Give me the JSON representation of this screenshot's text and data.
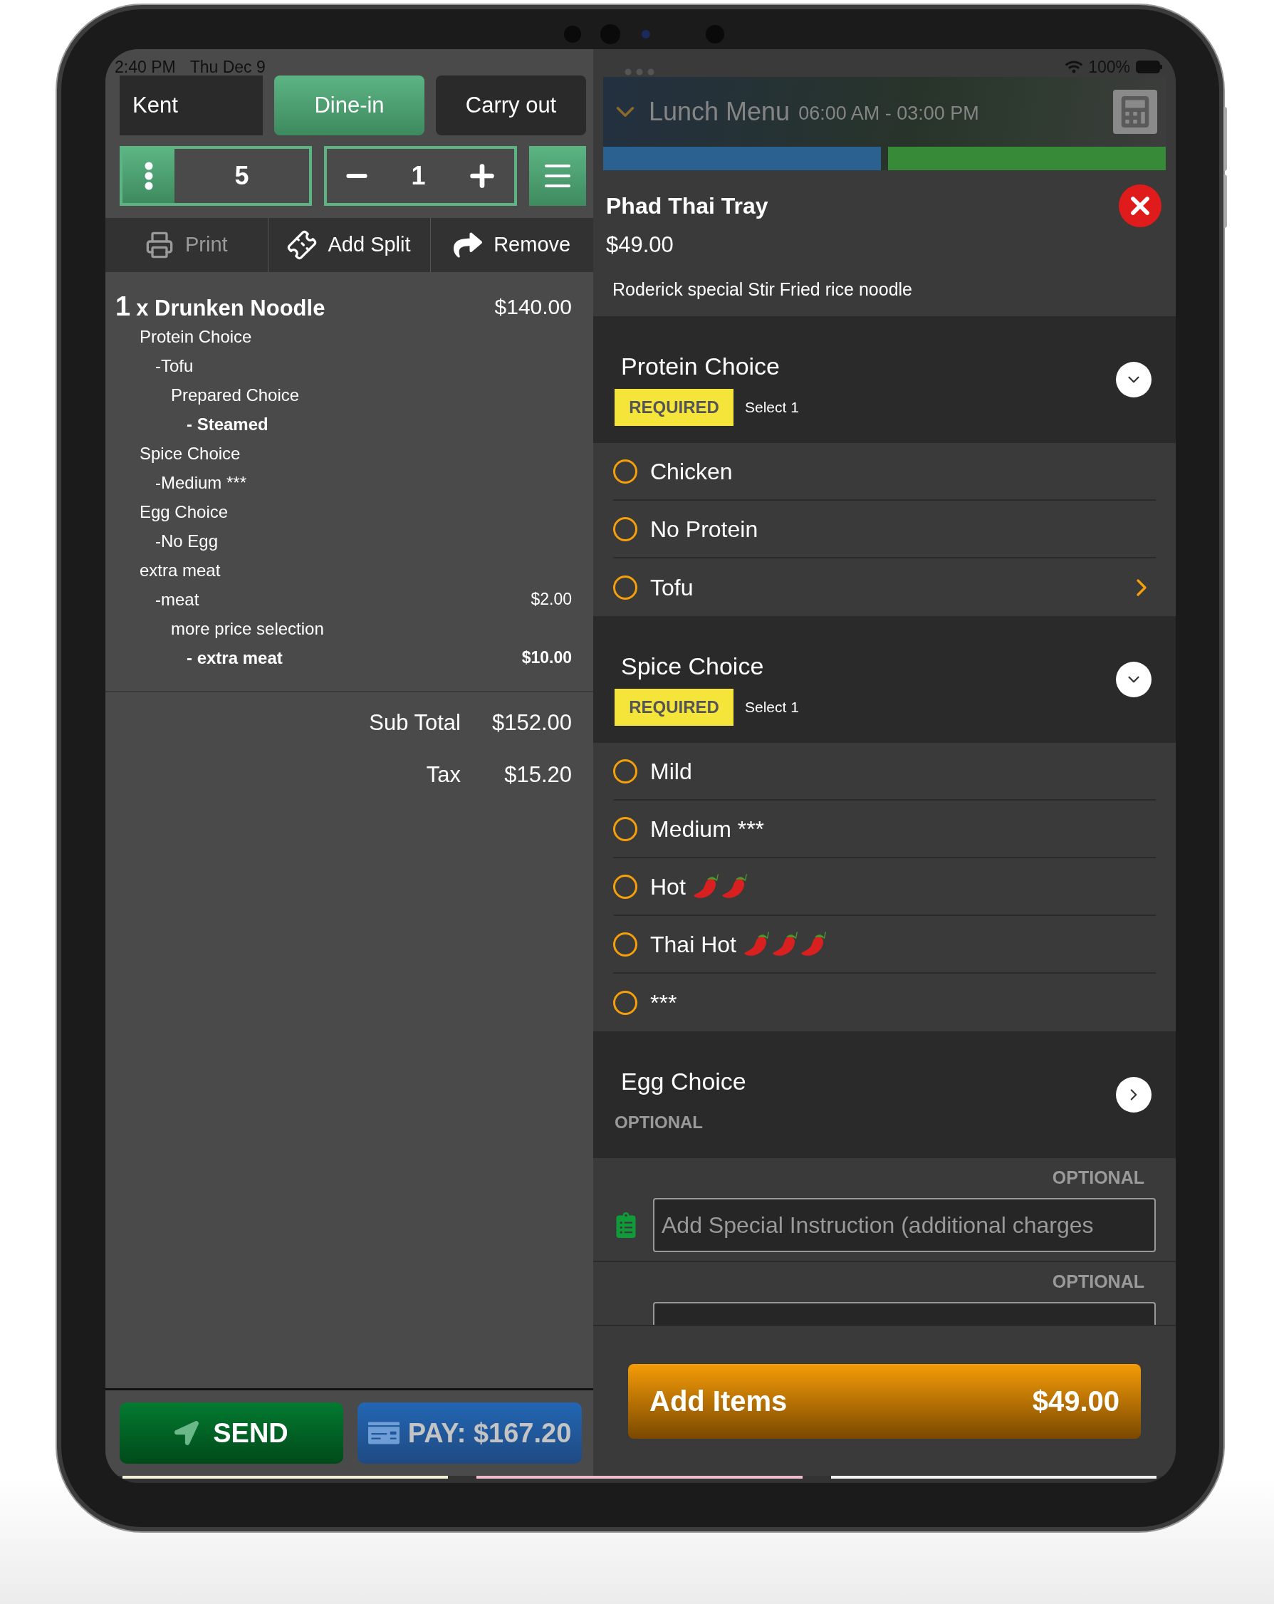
{
  "status_bar": {
    "time": "2:40 PM",
    "date": "Thu Dec 9",
    "battery": "100%"
  },
  "order_header": {
    "customer": "Kent",
    "order_types": [
      {
        "label": "Dine-in",
        "selected": true
      },
      {
        "label": "Carry out",
        "selected": false
      }
    ]
  },
  "counters": {
    "guests": "5",
    "quantity": "1"
  },
  "toolbar": [
    {
      "kind": "print",
      "label": "Print",
      "disabled": true
    },
    {
      "kind": "split",
      "label": "Add Split",
      "disabled": false
    },
    {
      "kind": "remove",
      "label": "Remove",
      "disabled": false
    }
  ],
  "order_items": [
    {
      "qty": "1",
      "name": "x Drunken Noodle",
      "price": "$140.00",
      "modifiers": [
        {
          "label": "Protein Choice",
          "children": [
            {
              "label": "-Tofu",
              "children": [
                {
                  "label": "Prepared Choice",
                  "children": [
                    {
                      "label": "- Steamed"
                    }
                  ]
                }
              ]
            }
          ]
        },
        {
          "label": "Spice Choice",
          "children": [
            {
              "label": "-Medium ***"
            }
          ]
        },
        {
          "label": "Egg Choice",
          "children": [
            {
              "label": "-No Egg"
            }
          ]
        },
        {
          "label": "extra meat",
          "children": [
            {
              "label": "-meat",
              "price": "$2.00",
              "children": [
                {
                  "label": "more price selection",
                  "children": [
                    {
                      "label": "- extra meat",
                      "price": "$10.00"
                    }
                  ]
                }
              ]
            }
          ]
        }
      ]
    }
  ],
  "totals": [
    {
      "label": "Sub Total",
      "value": "$152.00"
    },
    {
      "label": "Tax",
      "value": "$15.20"
    }
  ],
  "actions": {
    "send": "SEND",
    "pay": "PAY: $167.20"
  },
  "menu": {
    "name": "Lunch Menu",
    "hours": "06:00 AM - 03:00 PM",
    "categories": [
      {
        "color": "#2b6190"
      },
      {
        "color": "#378a37"
      }
    ]
  },
  "item": {
    "name": "Phad Thai Tray",
    "price": "$49.00",
    "description": "Roderick special Stir Fried rice noodle"
  },
  "modifier_groups": [
    {
      "title": "Protein Choice",
      "requirement": "REQUIRED",
      "required": true,
      "rule": "Select 1",
      "expanded": true,
      "options": [
        {
          "label": "Chicken",
          "selected": false,
          "has_submenu": false
        },
        {
          "label": "No Protein",
          "selected": false,
          "has_submenu": false
        },
        {
          "label": "Tofu",
          "selected": false,
          "has_submenu": true
        }
      ]
    },
    {
      "title": "Spice Choice",
      "requirement": "REQUIRED",
      "required": true,
      "rule": "Select 1",
      "expanded": true,
      "options": [
        {
          "label": "Mild",
          "selected": false,
          "has_submenu": false
        },
        {
          "label": "Medium ***",
          "selected": false,
          "has_submenu": false
        },
        {
          "label": "Hot",
          "icons": [
            {
              "kind": "chili"
            },
            {
              "kind": "chili"
            }
          ],
          "selected": false,
          "has_submenu": false
        },
        {
          "label": "Thai Hot",
          "icons": [
            {
              "kind": "chili"
            },
            {
              "kind": "chili"
            },
            {
              "kind": "chili"
            }
          ],
          "selected": false,
          "has_submenu": false
        },
        {
          "label": "***",
          "selected": false,
          "has_submenu": false
        }
      ]
    },
    {
      "title": "Egg Choice",
      "requirement": "OPTIONAL",
      "required": false,
      "expanded": false
    }
  ],
  "extras": [
    {
      "kind": "instruction",
      "tag": "OPTIONAL",
      "placeholder": "Add Special Instruction (additional charges"
    },
    {
      "kind": "price",
      "tag": "OPTIONAL"
    }
  ],
  "add_button": {
    "label": "Add Items",
    "price": "$49.00"
  }
}
